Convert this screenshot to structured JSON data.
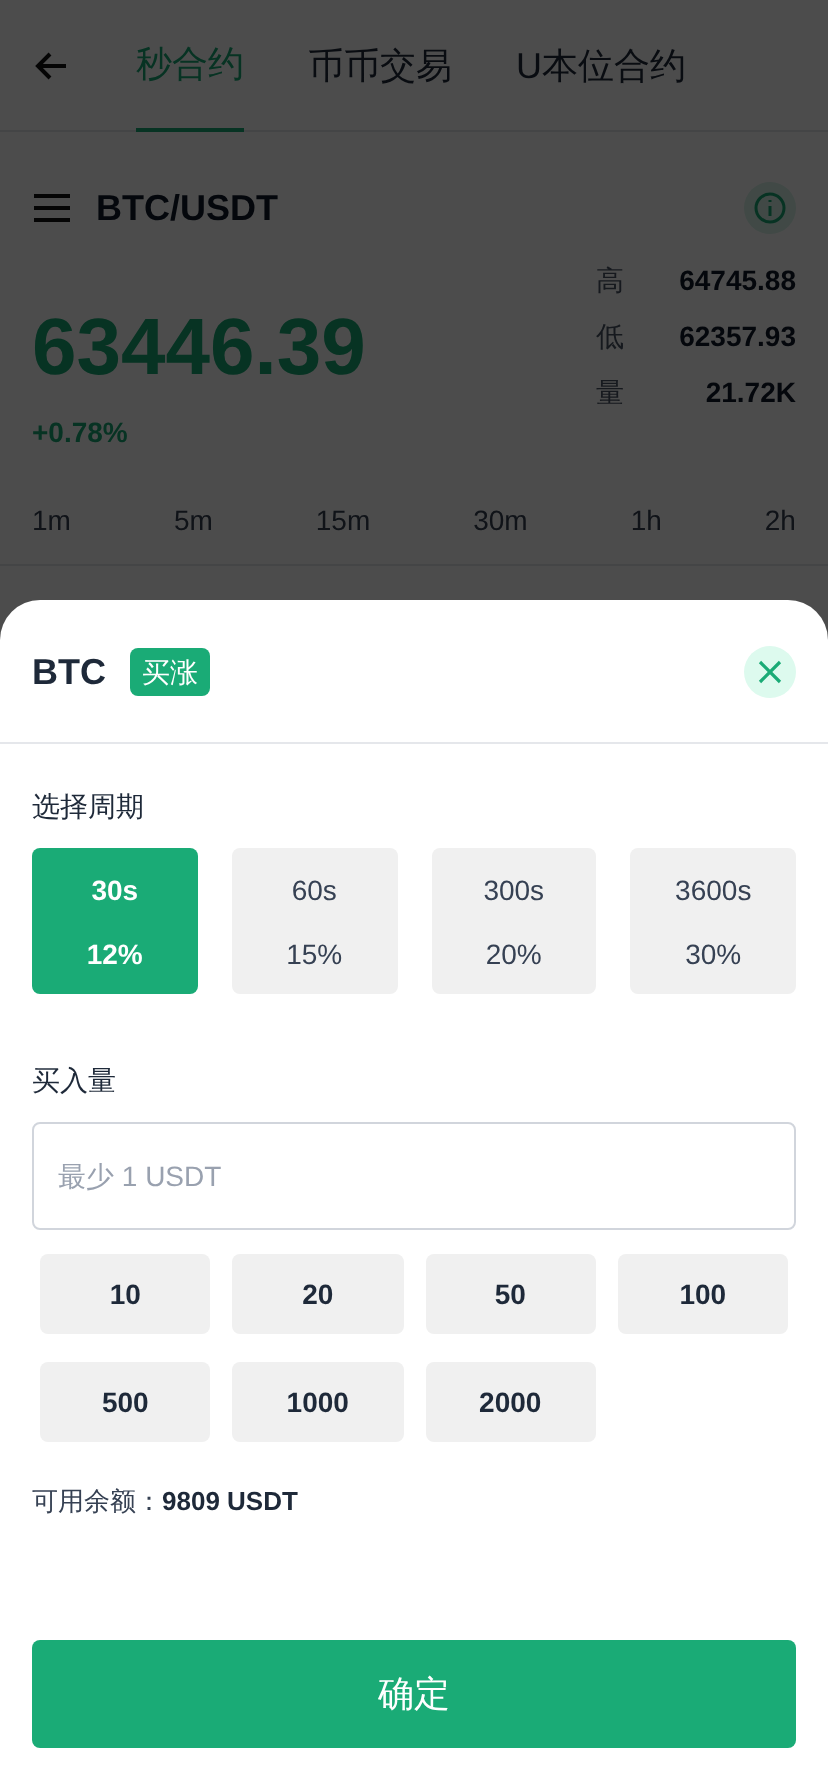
{
  "header": {
    "tabs": [
      {
        "label": "秒合约",
        "selected": true
      },
      {
        "label": "币币交易",
        "selected": false
      },
      {
        "label": "U本位合约",
        "selected": false
      }
    ]
  },
  "ticker": {
    "pair": "BTC/USDT",
    "price": "63446.39",
    "change": "+0.78%",
    "stats": [
      {
        "label": "高",
        "value": "64745.88"
      },
      {
        "label": "低",
        "value": "62357.93"
      },
      {
        "label": "量",
        "value": "21.72K"
      }
    ]
  },
  "intervals": [
    "1m",
    "5m",
    "15m",
    "30m",
    "1h",
    "2h"
  ],
  "sheet": {
    "coin": "BTC",
    "side": "买涨",
    "period_title": "选择周期",
    "periods": [
      {
        "time": "30s",
        "rate": "12%",
        "selected": true
      },
      {
        "time": "60s",
        "rate": "15%",
        "selected": false
      },
      {
        "time": "300s",
        "rate": "20%",
        "selected": false
      },
      {
        "time": "3600s",
        "rate": "30%",
        "selected": false
      }
    ],
    "amount_title": "买入量",
    "amount_placeholder": "最少 1 USDT",
    "amounts": [
      "10",
      "20",
      "50",
      "100",
      "500",
      "1000",
      "2000"
    ],
    "balance_label": "可用余额：",
    "balance_value": "9809 USDT",
    "confirm": "确定"
  }
}
